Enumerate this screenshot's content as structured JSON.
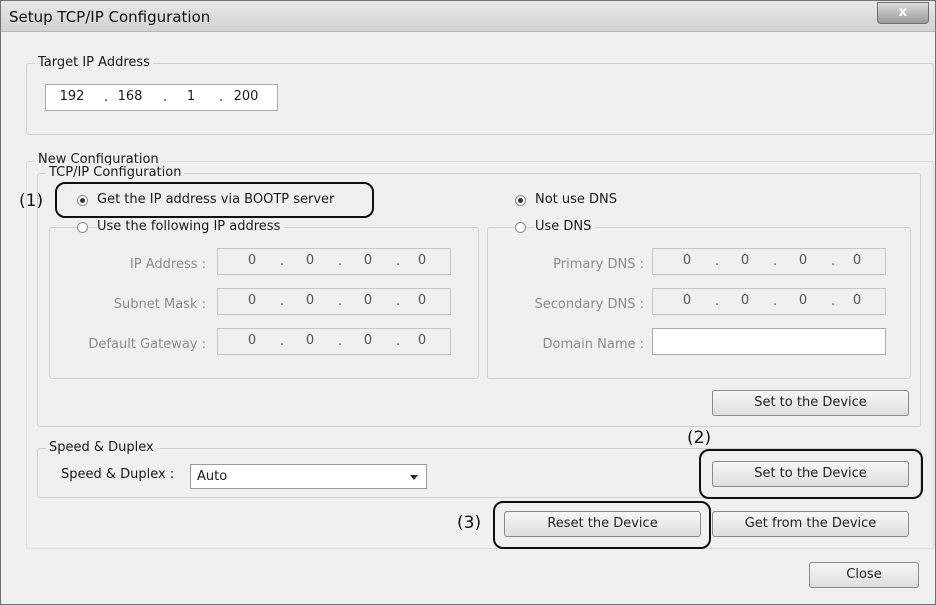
{
  "window": {
    "title": "Setup TCP/IP Configuration",
    "close_label": "x"
  },
  "target": {
    "group_title": "Target IP Address",
    "octets": [
      "192",
      "168",
      "1",
      "200"
    ]
  },
  "new_config": {
    "group_title": "New Configuration",
    "tcpip": {
      "group_title": "TCP/IP Configuration",
      "bootp_label": "Get the IP address via BOOTP server",
      "bootp_selected": true,
      "manual_label": "Use the following IP address",
      "manual_selected": false,
      "fields": [
        {
          "label": "IP Address :",
          "octets": [
            "0",
            "0",
            "0",
            "0"
          ]
        },
        {
          "label": "Subnet Mask :",
          "octets": [
            "0",
            "0",
            "0",
            "0"
          ]
        },
        {
          "label": "Default Gateway :",
          "octets": [
            "0",
            "0",
            "0",
            "0"
          ]
        }
      ],
      "dns": {
        "not_use_label": "Not use DNS",
        "not_use_selected": true,
        "use_label": "Use DNS",
        "use_selected": false,
        "fields": [
          {
            "label": "Primary DNS :",
            "octets": [
              "0",
              "0",
              "0",
              "0"
            ]
          },
          {
            "label": "Secondary DNS :",
            "octets": [
              "0",
              "0",
              "0",
              "0"
            ]
          }
        ],
        "domain_label": "Domain Name :",
        "domain_value": ""
      },
      "set_button": "Set to the Device"
    },
    "speed": {
      "group_title": "Speed & Duplex",
      "label": "Speed & Duplex :",
      "value": "Auto",
      "set_button": "Set to the Device"
    },
    "reset_button": "Reset the Device",
    "get_button": "Get from the Device"
  },
  "close_button": "Close",
  "markers": {
    "one": "(1)",
    "two": "(2)",
    "three": "(3)"
  }
}
